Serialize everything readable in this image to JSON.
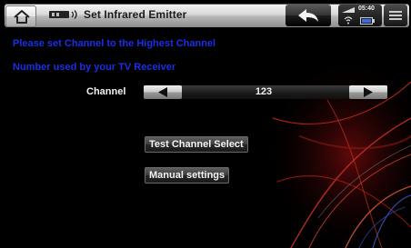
{
  "header": {
    "title": "Set Infrared Emitter",
    "time": "05:40",
    "icons": {
      "home": "home-icon",
      "ir": "infrared-emitter-icon",
      "back": "back-arrow-icon",
      "signal": "signal-icon",
      "wifi": "wifi-icon",
      "battery": "battery-icon",
      "menu": "menu-icon"
    }
  },
  "instructions": {
    "line1": "Please set Channel to the Highest Channel",
    "line2": "Number used by your TV Receiver"
  },
  "channel": {
    "label": "Channel",
    "value": "123"
  },
  "buttons": {
    "test": "Test Channel Select",
    "manual": "Manual settings"
  },
  "colors": {
    "instruction_text": "#1a2ee8",
    "background": "#000000"
  }
}
